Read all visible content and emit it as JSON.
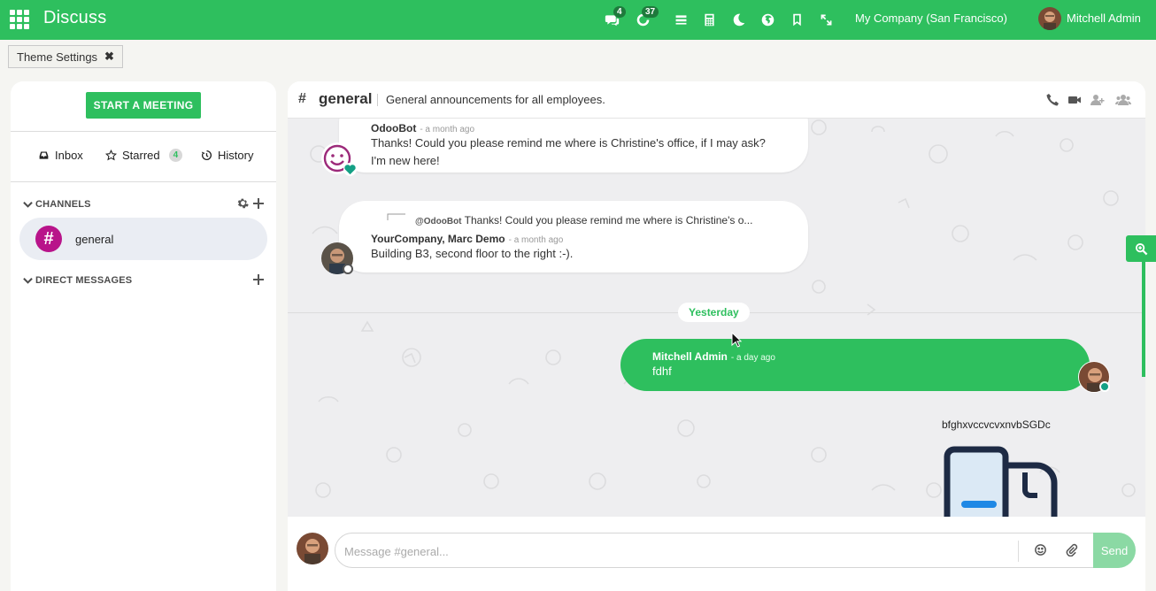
{
  "app": {
    "title": "Discuss"
  },
  "navbar": {
    "messages_count": "4",
    "activities_count": "37",
    "company": "My Company (San Francisco)",
    "user_name": "Mitchell Admin",
    "icons": [
      "apps-icon",
      "messages-icon",
      "activities-icon",
      "list-icon",
      "calculator-icon",
      "moon-icon",
      "globe-icon",
      "bookmark-icon",
      "expand-icon"
    ]
  },
  "breadcrumb": {
    "theme_settings": "Theme Settings",
    "close_glyph": "✖"
  },
  "sidebar": {
    "start_meeting": "START A MEETING",
    "mailboxes": [
      {
        "label": "Inbox"
      },
      {
        "label": "Starred",
        "count": "4"
      },
      {
        "label": "History"
      }
    ],
    "channels_header": "CHANNELS",
    "channels": [
      {
        "name": "general",
        "avatar": "#"
      }
    ],
    "dm_header": "DIRECT MESSAGES"
  },
  "channel": {
    "hash": "#",
    "name": "general",
    "description": "General announcements for all employees."
  },
  "messages": [
    {
      "author": "OdooBot",
      "date": "- a month ago",
      "lines": [
        "Thanks! Could you please remind me where is Christine's office, if I may ask?",
        "I'm new here!"
      ]
    },
    {
      "reply_to_author": "@OdooBot",
      "reply_to_text": "Thanks! Could you please remind me where is Christine's o...",
      "author": "YourCompany, Marc Demo",
      "date": "- a month ago",
      "lines": [
        "Building B3, second floor to the right :-)."
      ]
    }
  ],
  "day_separator": "Yesterday",
  "my_message": {
    "author": "Mitchell Admin",
    "date": "- a day ago",
    "text": "fdhf"
  },
  "attachment": {
    "name": "bfghxvccvcvxnvbSGDc"
  },
  "composer": {
    "placeholder": "Message #general...",
    "send_label": "Send"
  },
  "colors": {
    "brand": "#2ebf5e",
    "channel_avatar": "#b8148a",
    "online": "#14a085"
  }
}
